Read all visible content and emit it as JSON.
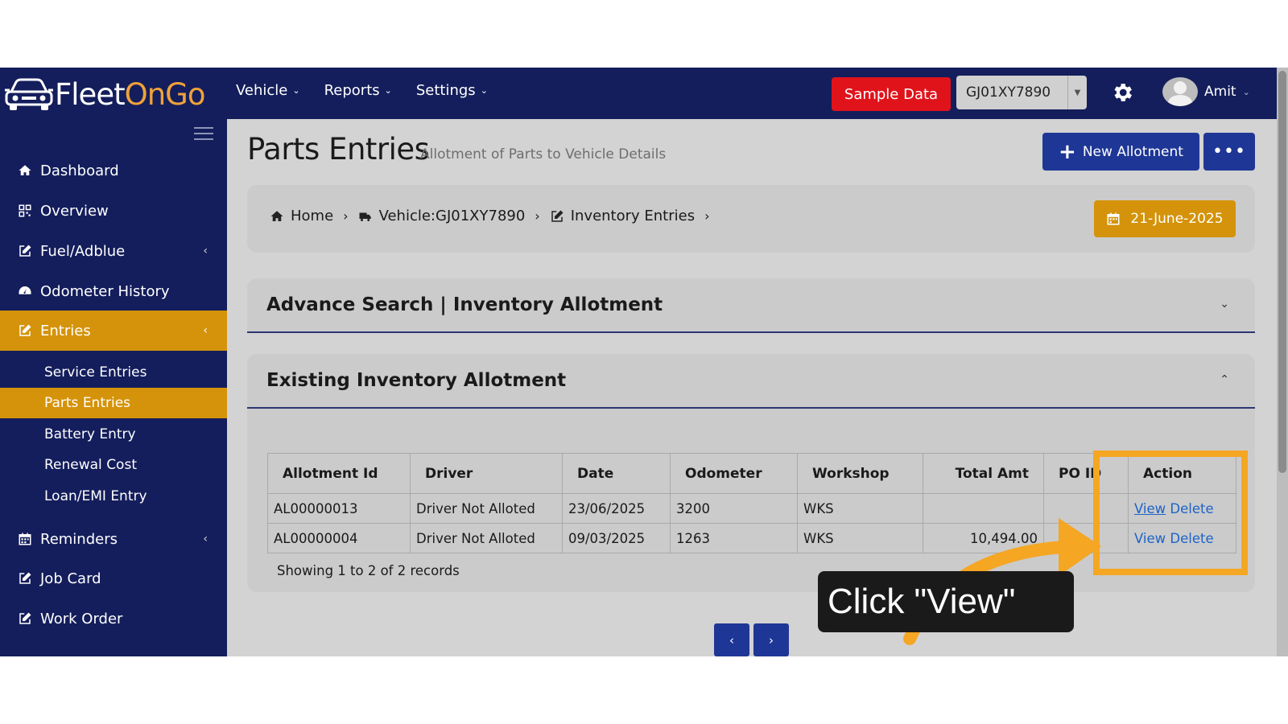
{
  "app": {
    "logo_part1": "Fleet",
    "logo_part2": "OnGo"
  },
  "topnav": {
    "items": [
      {
        "label": "Vehicle"
      },
      {
        "label": "Reports"
      },
      {
        "label": "Settings"
      }
    ],
    "sample_data_label": "Sample Data",
    "vehicle_select_value": "GJ01XY7890",
    "user_name": "Amit"
  },
  "sidebar": {
    "items": [
      {
        "label": "Dashboard",
        "icon": "home-icon"
      },
      {
        "label": "Overview",
        "icon": "qrcode-icon"
      },
      {
        "label": "Fuel/Adblue",
        "icon": "edit-icon"
      },
      {
        "label": "Odometer History",
        "icon": "gauge-icon"
      },
      {
        "label": "Entries",
        "icon": "edit-icon"
      },
      {
        "label": "Reminders",
        "icon": "calendar-icon"
      },
      {
        "label": "Job Card",
        "icon": "edit-icon"
      },
      {
        "label": "Work Order",
        "icon": "edit-icon"
      }
    ],
    "sub_items": [
      {
        "label": "Service Entries"
      },
      {
        "label": "Parts Entries"
      },
      {
        "label": "Battery Entry"
      },
      {
        "label": "Renewal Cost"
      },
      {
        "label": "Loan/EMI Entry"
      }
    ],
    "active_item": "Entries",
    "active_sub_item": "Parts Entries"
  },
  "page": {
    "title": "Parts Entries",
    "subtitle": "Allotment of Parts to Vehicle Details",
    "new_button_label": "New Allotment",
    "more_button_label": "•••"
  },
  "breadcrumb": {
    "items": [
      {
        "label": "Home",
        "icon": "home-icon"
      },
      {
        "label": "Vehicle:GJ01XY7890",
        "icon": "truck-icon"
      },
      {
        "label": "Inventory Entries",
        "icon": "edit-icon"
      }
    ],
    "date_label": "21-June-2025"
  },
  "search_card": {
    "title": "Advance Search | Inventory Allotment"
  },
  "list_card": {
    "title": "Existing Inventory Allotment",
    "columns": [
      "Allotment Id",
      "Driver",
      "Date",
      "Odometer",
      "Workshop",
      "Total Amt",
      "PO ID",
      "Action"
    ],
    "rows": [
      {
        "allotment_id": "AL00000013",
        "driver": "Driver Not Alloted",
        "date": "23/06/2025",
        "odometer": "3200",
        "workshop": "WKS",
        "total_amt": "",
        "po_id": "",
        "view": "View",
        "delete": "Delete"
      },
      {
        "allotment_id": "AL00000004",
        "driver": "Driver Not Alloted",
        "date": "09/03/2025",
        "odometer": "1263",
        "workshop": "WKS",
        "total_amt": "10,494.00",
        "po_id": "",
        "view": "View",
        "delete": "Delete"
      }
    ],
    "showing": "Showing 1 to 2 of 2 records"
  },
  "pager": {
    "prev": "‹",
    "next": "›"
  },
  "callout": {
    "text": "Click \"View\""
  },
  "colors": {
    "nav_bg": "#141e5c",
    "accent": "#d4930a",
    "primary_btn": "#1e3796",
    "danger": "#e0131b",
    "highlight": "#f5a623"
  }
}
